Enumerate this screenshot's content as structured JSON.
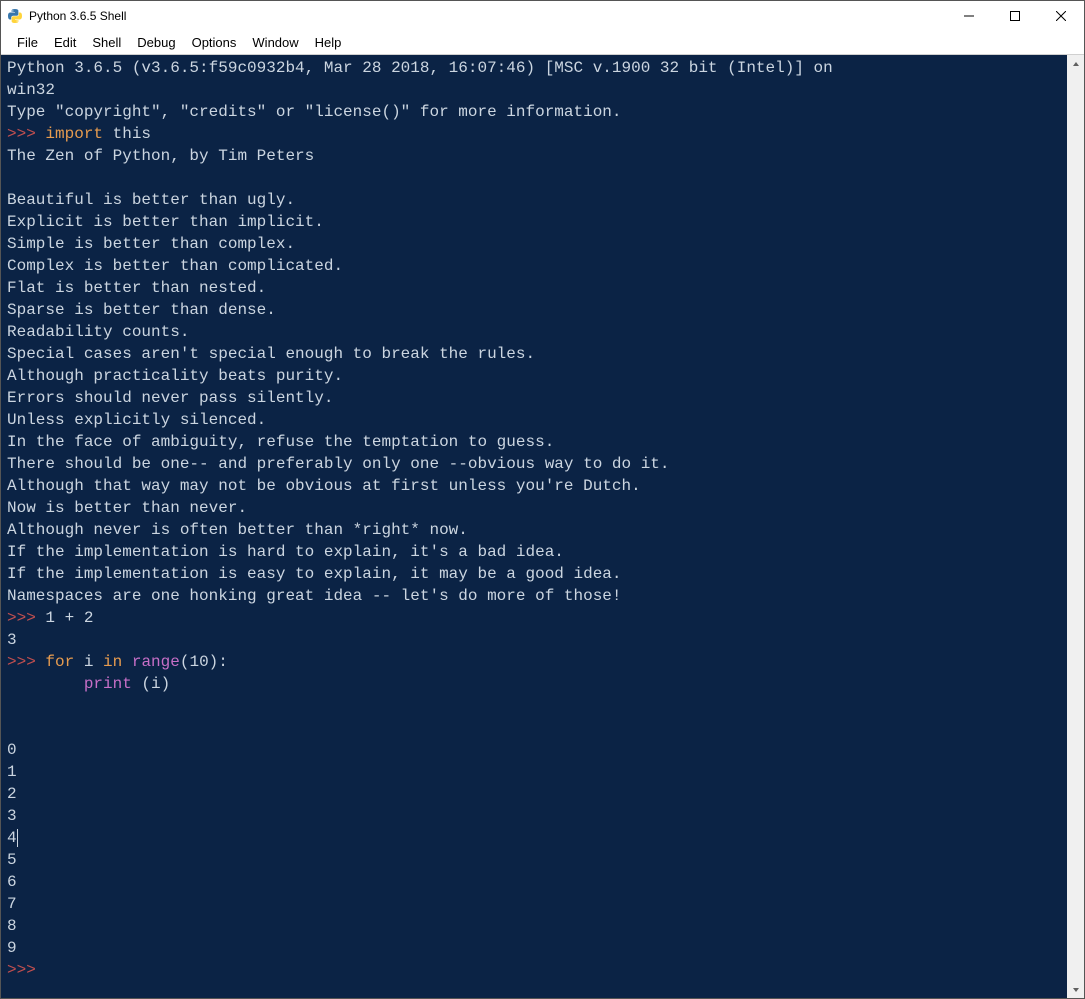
{
  "window": {
    "title": "Python 3.6.5 Shell"
  },
  "menu": {
    "items": [
      "File",
      "Edit",
      "Shell",
      "Debug",
      "Options",
      "Window",
      "Help"
    ]
  },
  "colors": {
    "terminal_bg": "#0b2345",
    "terminal_fg": "#cbd5e0",
    "prompt": "#c24f4f",
    "keyword": "#e69b4f",
    "builtin": "#c76fc7"
  },
  "shell": {
    "banner": [
      "Python 3.6.5 (v3.6.5:f59c0932b4, Mar 28 2018, 16:07:46) [MSC v.1900 32 bit (Intel)] on",
      "win32",
      "Type \"copyright\", \"credits\" or \"license()\" for more information."
    ],
    "prompt": ">>> ",
    "entries": [
      {
        "input_tokens": [
          {
            "t": "import",
            "c": "keyword"
          },
          {
            "t": " this",
            "c": "text"
          }
        ],
        "output": [
          "The Zen of Python, by Tim Peters",
          "",
          "Beautiful is better than ugly.",
          "Explicit is better than implicit.",
          "Simple is better than complex.",
          "Complex is better than complicated.",
          "Flat is better than nested.",
          "Sparse is better than dense.",
          "Readability counts.",
          "Special cases aren't special enough to break the rules.",
          "Although practicality beats purity.",
          "Errors should never pass silently.",
          "Unless explicitly silenced.",
          "In the face of ambiguity, refuse the temptation to guess.",
          "There should be one-- and preferably only one --obvious way to do it.",
          "Although that way may not be obvious at first unless you're Dutch.",
          "Now is better than never.",
          "Although never is often better than *right* now.",
          "If the implementation is hard to explain, it's a bad idea.",
          "If the implementation is easy to explain, it may be a good idea.",
          "Namespaces are one honking great idea -- let's do more of those!"
        ]
      },
      {
        "input_tokens": [
          {
            "t": "1 + 2",
            "c": "text"
          }
        ],
        "output": [
          "3"
        ]
      },
      {
        "input_tokens": [
          {
            "t": "for",
            "c": "keyword"
          },
          {
            "t": " i ",
            "c": "text"
          },
          {
            "t": "in",
            "c": "keyword"
          },
          {
            "t": " ",
            "c": "text"
          },
          {
            "t": "range",
            "c": "builtin"
          },
          {
            "t": "(10):",
            "c": "text"
          }
        ],
        "continuation": [
          [
            {
              "t": "        ",
              "c": "text"
            },
            {
              "t": "print",
              "c": "builtin"
            },
            {
              "t": " (i)",
              "c": "text"
            }
          ],
          []
        ],
        "output": [
          "",
          "0",
          "1",
          "2",
          "3",
          "4",
          "5",
          "6",
          "7",
          "8",
          "9"
        ]
      }
    ],
    "cursor_after_line": "4",
    "trailing_prompt": true
  }
}
